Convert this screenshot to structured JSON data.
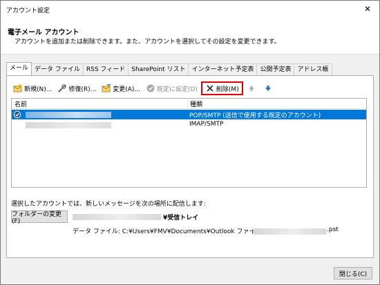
{
  "window": {
    "title": "アカウント設定"
  },
  "header": {
    "title": "電子メール アカウント",
    "description": "アカウントを追加または削除できます。また、アカウントを選択してその設定を変更できます。"
  },
  "tabs": [
    {
      "label": "メール",
      "active": true
    },
    {
      "label": "データ ファイル"
    },
    {
      "label": "RSS フィード"
    },
    {
      "label": "SharePoint リスト"
    },
    {
      "label": "インターネット予定表"
    },
    {
      "label": "公開予定表"
    },
    {
      "label": "アドレス帳"
    }
  ],
  "toolbar": {
    "new_label": "新規(N)...",
    "repair_label": "修復(R)...",
    "change_label": "変更(A)...",
    "default_label": "既定に設定(D)",
    "delete_label": "削除(M)"
  },
  "list": {
    "col_name": "名前",
    "col_type": "種類",
    "rows": [
      {
        "type": "POP/SMTP (送信で使用する既定のアカウント)",
        "selected": true
      },
      {
        "type": "IMAP/SMTP",
        "selected": false
      }
    ]
  },
  "delivery": {
    "text": "選択したアカウントでは、新しいメッセージを次の場所に配信します:",
    "folder_button": "フォルダーの変更(F)",
    "inbox_label": "¥受信トレイ",
    "datafile_label": "データ ファイル: C:¥Users¥FMV¥Documents¥Outlook ファイル¥",
    "datafile_ext": ".pst"
  },
  "footer": {
    "close_label": "閉じる(C)"
  },
  "colors": {
    "selection": "#0078d7",
    "highlight_border": "#e00000",
    "arrow_blue": "#1f6fd1"
  }
}
